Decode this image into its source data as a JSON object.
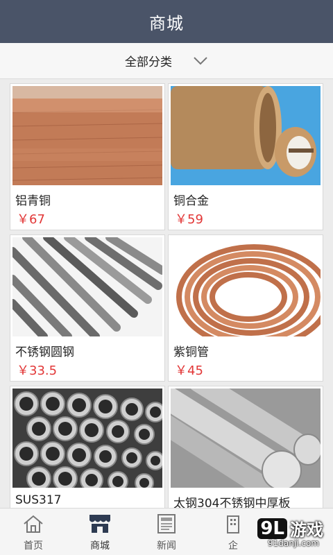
{
  "header": {
    "title": "商城"
  },
  "filter": {
    "label": "全部分类",
    "icon": "chevron-down-icon"
  },
  "products": [
    {
      "name": "铝青铜",
      "price": "￥67",
      "image": "copper-plates"
    },
    {
      "name": "铜合金",
      "price": "￥59",
      "image": "copper-coils"
    },
    {
      "name": "不锈钢圆钢",
      "price": "￥33.5",
      "image": "steel-rods"
    },
    {
      "name": "紫铜管",
      "price": "￥45",
      "image": "copper-tube-coil"
    },
    {
      "name": "SUS317",
      "price": "",
      "image": "steel-pipes"
    },
    {
      "name": "太钢304不锈钢中厚板",
      "price": "",
      "image": "steel-bars"
    }
  ],
  "tabbar": {
    "items": [
      {
        "label": "首页",
        "icon": "home-icon"
      },
      {
        "label": "商城",
        "icon": "store-icon",
        "active": true
      },
      {
        "label": "新闻",
        "icon": "news-icon"
      },
      {
        "label": "企",
        "icon": "company-icon"
      },
      {
        "label": "",
        "icon": "more-icon"
      }
    ]
  },
  "watermark": {
    "logo": "9L",
    "text": "游戏",
    "url": "91danji.com"
  },
  "colors": {
    "header_bg": "#4a5468",
    "price": "#e23737",
    "background": "#ececec"
  }
}
